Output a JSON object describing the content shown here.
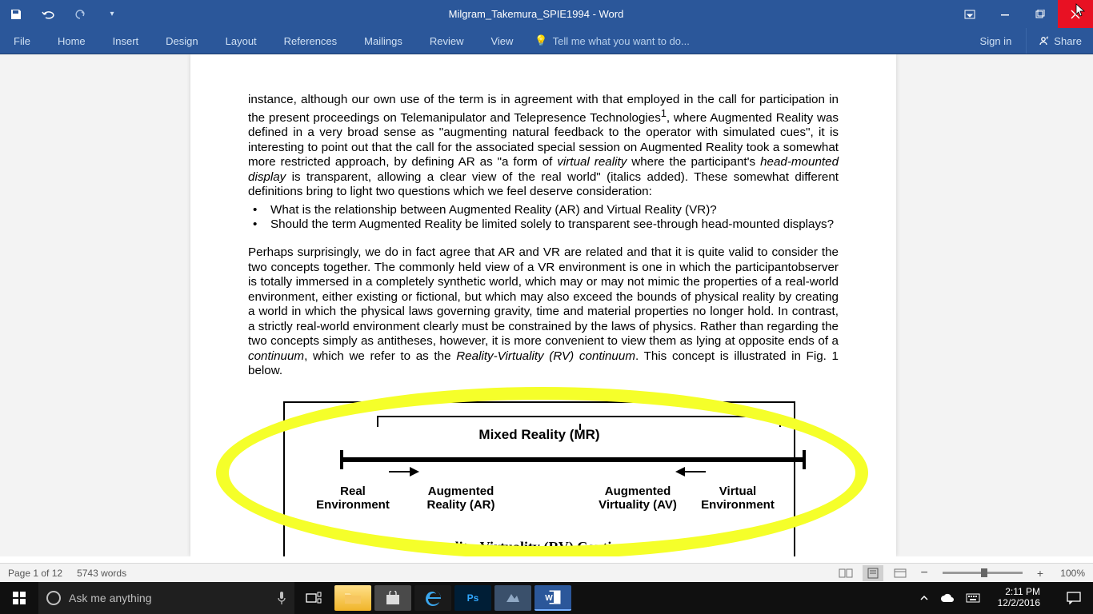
{
  "title": "Milgram_Takemura_SPIE1994 - Word",
  "ribbon": {
    "file": "File",
    "tabs": [
      "Home",
      "Insert",
      "Design",
      "Layout",
      "References",
      "Mailings",
      "Review",
      "View"
    ],
    "tell_me": "Tell me what you want to do...",
    "signin": "Sign in",
    "share": "Share"
  },
  "document": {
    "p1a": "instance, although our own use of the term is in agreement with that employed in the call for participation in the present proceedings on Telemanipulator and Telepresence Technologies",
    "p1b": ", where Augmented Reality was defined in a very broad sense as \"augmenting natural feedback to the operator with simulated cues\", it is interesting to point out that the call for the associated special session on Augmented Reality took a somewhat more restricted approach, by defining AR as \"a form of ",
    "p1c": "virtual reality",
    "p1d": " where the participant's ",
    "p1e": "head-mounted display",
    "p1f": " is transparent, allowing a clear view of the real world\" (italics added). These somewhat different definitions bring to light two questions which we feel deserve consideration:",
    "bullets": [
      "What is the relationship between Augmented Reality (AR) and Virtual Reality (VR)?",
      "Should the term Augmented Reality be limited solely to transparent see-through head-mounted displays?"
    ],
    "p2a": "Perhaps surprisingly, we do in fact agree that AR and VR are related and that it is quite valid to consider the two concepts together. The commonly held view of a VR environment is one in which the participantobserver is totally immersed in a completely synthetic world, which may or may not mimic the properties of a real-world environment, either existing or fictional, but which may also exceed the bounds of physical reality by creating a world in which the physical laws governing gravity, time and material properties no longer hold. In contrast, a strictly real-world environment clearly must be constrained by the laws of physics. Rather than regarding the two concepts simply as antitheses, however, it is more convenient to view them as lying at opposite ends of a ",
    "p2b": "continuum",
    "p2c": ", which we refer to as the ",
    "p2d": "Reality-Virtuality (RV) continuum",
    "p2e": ". This concept is illustrated in Fig. 1 below.",
    "figure": {
      "title": "Mixed Reality (MR)",
      "labels": {
        "real": "Real\nEnvironment",
        "ar": "Augmented\nReality (AR)",
        "av": "Augmented\nVirtuality (AV)",
        "ve": "Virtual\nEnvironment"
      },
      "caption": "Reality-Virtuality (RV) Continuum"
    }
  },
  "status": {
    "page": "Page 1 of 12",
    "words": "5743 words",
    "zoom": "100%"
  },
  "taskbar": {
    "search_placeholder": "Ask me anything",
    "time": "2:11 PM",
    "date": "12/2/2016",
    "apps": {
      "ps": "Ps",
      "word": "W"
    }
  }
}
